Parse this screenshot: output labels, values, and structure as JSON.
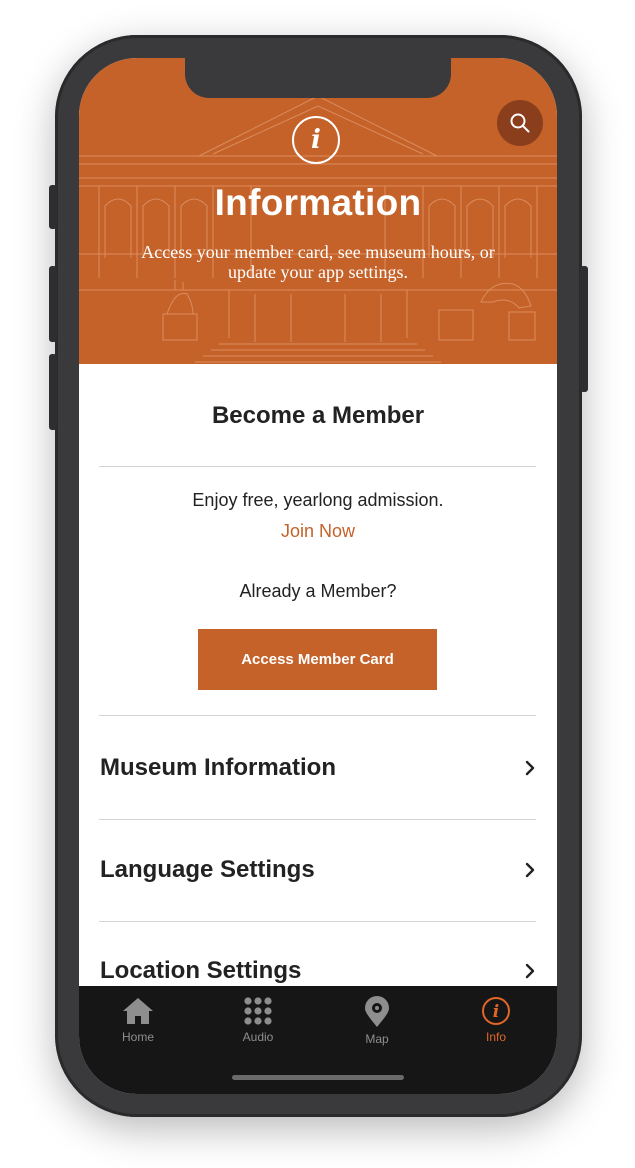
{
  "header": {
    "title": "Information",
    "subtitle": "Access your member card, see museum hours, or update your app settings.",
    "search_icon": "search-icon",
    "badge_icon": "info-icon",
    "badge_glyph": "i"
  },
  "membership": {
    "title": "Become a Member",
    "description": "Enjoy free, yearlong admission.",
    "join_link": "Join Now",
    "already_member": "Already a Member?",
    "card_button": "Access Member Card"
  },
  "menu": [
    {
      "label": "Museum Information",
      "icon": "chevron-right-icon"
    },
    {
      "label": "Language Settings",
      "icon": "chevron-right-icon"
    },
    {
      "label": "Location Settings",
      "icon": "chevron-right-icon"
    }
  ],
  "tabs": [
    {
      "label": "Home",
      "icon": "home-icon",
      "active": false
    },
    {
      "label": "Audio",
      "icon": "keypad-icon",
      "active": false
    },
    {
      "label": "Map",
      "icon": "map-pin-icon",
      "active": false
    },
    {
      "label": "Info",
      "icon": "info-icon",
      "active": true
    }
  ],
  "colors": {
    "accent": "#c4622a",
    "tab_active": "#e0672a",
    "tab_bar": "#161616",
    "text": "#222222"
  }
}
